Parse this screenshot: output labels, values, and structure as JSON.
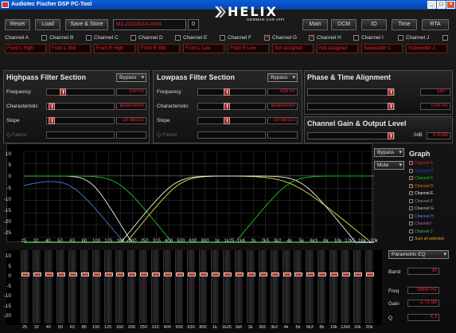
{
  "window": {
    "title": "Audiotec Fischer DSP PC-Tool",
    "controls": [
      "_",
      "□",
      "×"
    ]
  },
  "toolbar": {
    "reset": "Reset",
    "load": "Load",
    "save_store": "Save & Store",
    "preset_name": "M1-22102014-2004",
    "preset_number": "0",
    "nav": [
      "Main",
      "DCM",
      "IO",
      "Time",
      "RTA"
    ]
  },
  "logo": {
    "brand": "HELIX",
    "tagline": "GERMAN CAR HIFI"
  },
  "channels": [
    {
      "label": "Channel A",
      "checked": false,
      "name": "Front L High"
    },
    {
      "label": "Channel B",
      "checked": false,
      "name": "Front L Mid"
    },
    {
      "label": "Channel C",
      "checked": false,
      "name": "Front R High"
    },
    {
      "label": "Channel D",
      "checked": false,
      "name": "Front R Mid"
    },
    {
      "label": "Channel E",
      "checked": false,
      "name": "Front L Low"
    },
    {
      "label": "Channel F",
      "checked": true,
      "name": "Front R Low"
    },
    {
      "label": "Channel G",
      "checked": true,
      "name": "Not assigned"
    },
    {
      "label": "Channel H",
      "checked": false,
      "name": "Not assigned"
    },
    {
      "label": "Channel I",
      "checked": false,
      "name": "Subwoofer 1"
    },
    {
      "label": "Channel J",
      "checked": false,
      "name": "Subwoofer 2"
    }
  ],
  "highpass": {
    "title": "Highpass Filter Section",
    "mode": "Bypass",
    "frequency_label": "Frequency",
    "frequency_value": "100 Hz",
    "characteristic_label": "Characteristic",
    "characteristic_value": "Butterworth",
    "slope_label": "Slope",
    "slope_value": "-18 dB/Oct",
    "qfactor_label": "Q-Factor",
    "qfactor_value": ""
  },
  "lowpass": {
    "title": "Lowpass Filter Section",
    "mode": "Bypass",
    "frequency_label": "Frequency",
    "frequency_value": "428 Hz",
    "characteristic_label": "Characteristic",
    "characteristic_value": "Butterworth",
    "slope_label": "Slope",
    "slope_value": "-18 dB/Oct",
    "qfactor_label": "Q-Factor",
    "qfactor_value": ""
  },
  "phase_time": {
    "title": "Phase & Time Alignment",
    "phase_value": "180 °",
    "time_value": "0.00 ms"
  },
  "gain_output": {
    "title": "Channel Gain & Output Level",
    "db_label": "0dB",
    "level_value": "0.00dB"
  },
  "graph": {
    "ylabel": "dB",
    "yticks": [
      "10",
      "5",
      "0",
      "-5",
      "-10",
      "-15",
      "-20",
      "-25"
    ],
    "xticks": [
      "25",
      "32",
      "40",
      "50",
      "63",
      "80",
      "100",
      "125",
      "160",
      "200",
      "250",
      "315",
      "400",
      "500",
      "630",
      "800",
      "1k",
      "1k25",
      "1k6",
      "2k",
      "2k5",
      "3k2",
      "4k",
      "5k",
      "6k3",
      "8k",
      "10k",
      "12k5",
      "16k",
      "20k"
    ],
    "bypass": "Bypass",
    "mute": "Mute",
    "legend_title": "Graph",
    "legend": [
      {
        "label": "Channel A",
        "checked": true,
        "color": "#e02020"
      },
      {
        "label": "Channel B",
        "checked": true,
        "color": "#2040e0"
      },
      {
        "label": "Channel C",
        "checked": true,
        "color": "#20c020"
      },
      {
        "label": "Channel D",
        "checked": true,
        "color": "#e07020"
      },
      {
        "label": "Channel E",
        "checked": true,
        "color": "#f0f0f0"
      },
      {
        "label": "Channel F",
        "checked": false,
        "color": "#909090"
      },
      {
        "label": "Channel G",
        "checked": false,
        "color": "#c0c0c0"
      },
      {
        "label": "Channel H",
        "checked": false,
        "color": "#4a90e0"
      },
      {
        "label": "Channel I",
        "checked": true,
        "color": "#c060c0"
      },
      {
        "label": "Channel J",
        "checked": false,
        "color": "#30c060"
      },
      {
        "label": "Sum all selected",
        "checked": false,
        "color": "#e0a020"
      }
    ]
  },
  "eq": {
    "yticks": [
      "10",
      "5",
      "0",
      "-5",
      "-10",
      "-15",
      "-20"
    ],
    "xticks": [
      "25",
      "32",
      "40",
      "50",
      "63",
      "80",
      "100",
      "125",
      "160",
      "200",
      "250",
      "315",
      "400",
      "500",
      "630",
      "800",
      "1k",
      "1k25",
      "1k6",
      "2k",
      "2k5",
      "3k2",
      "4k",
      "5k",
      "6k3",
      "8k",
      "10k",
      "12k5",
      "16k",
      "20k"
    ],
    "mode": "Parametric EQ",
    "band_label": "Band",
    "band_value": "30",
    "freq_label": "Freq",
    "freq_value": "19980 Hz",
    "gain_label": "Gain",
    "gain_value": "-1.75 dB",
    "q_label": "Q",
    "q_value": "4.3"
  }
}
